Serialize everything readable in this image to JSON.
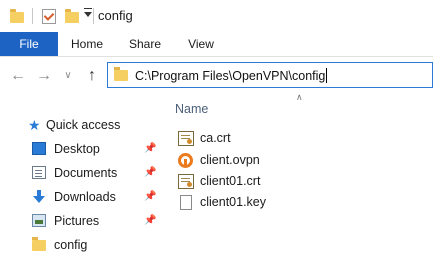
{
  "window": {
    "title": "config"
  },
  "ribbon": {
    "tabs": [
      {
        "label": "File"
      },
      {
        "label": "Home"
      },
      {
        "label": "Share"
      },
      {
        "label": "View"
      }
    ]
  },
  "address_bar": {
    "path": "C:\\Program Files\\OpenVPN\\config"
  },
  "nav_pane": {
    "quick_access_label": "Quick access",
    "items": [
      {
        "label": "Desktop",
        "icon": "desktop-icon",
        "pinned": true
      },
      {
        "label": "Documents",
        "icon": "documents-icon",
        "pinned": true
      },
      {
        "label": "Downloads",
        "icon": "downloads-icon",
        "pinned": true
      },
      {
        "label": "Pictures",
        "icon": "pictures-icon",
        "pinned": true
      },
      {
        "label": "config",
        "icon": "folder-icon",
        "pinned": false
      }
    ]
  },
  "content": {
    "column_header": "Name",
    "files": [
      {
        "name": "ca.crt",
        "icon": "certificate-icon"
      },
      {
        "name": "client.ovpn",
        "icon": "openvpn-config-icon"
      },
      {
        "name": "client01.crt",
        "icon": "certificate-icon"
      },
      {
        "name": "client01.key",
        "icon": "file-icon"
      }
    ]
  },
  "colors": {
    "accent": "#1c63c4",
    "address_border": "#2b7bd6",
    "folder": "#f6cf62"
  }
}
